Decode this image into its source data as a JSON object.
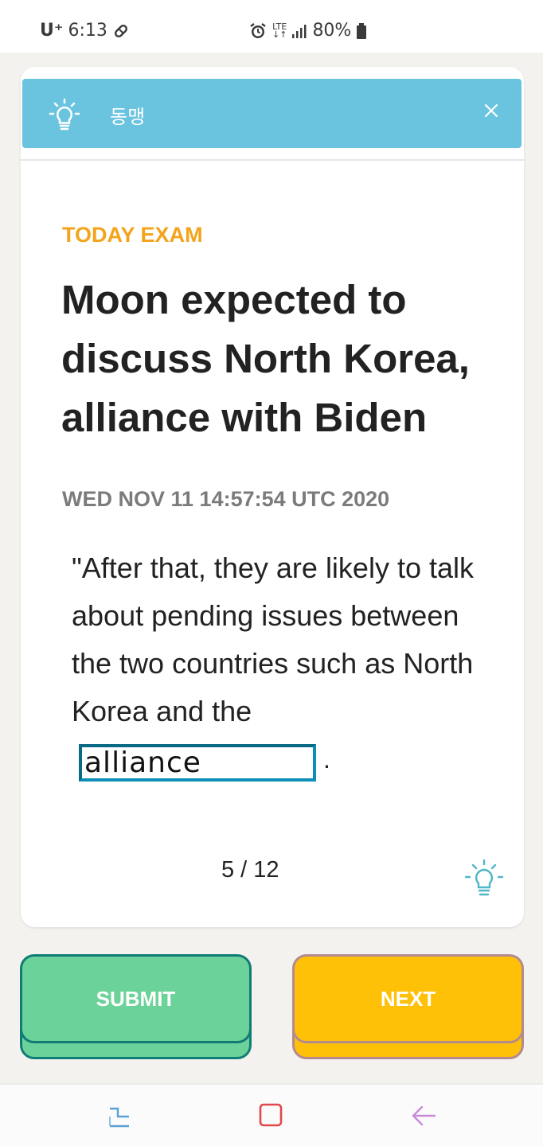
{
  "status_bar": {
    "carrier": "U⁺",
    "time": "6:13",
    "network": "LTE",
    "battery": "80%",
    "icons": [
      "pill-icon",
      "alarm-icon",
      "lte-icon",
      "signal-icon",
      "battery-icon"
    ]
  },
  "banner": {
    "label": "동맹",
    "icon": "lightbulb-icon",
    "close_icon": "close-icon",
    "color": "#6ac4df"
  },
  "exam": {
    "section_label": "TODAY EXAM",
    "headline": "Moon expected to discuss North Korea, alliance with Biden",
    "date": "WED NOV 11 14:57:54 UTC 2020",
    "quote": "\"After that, they are likely to talk about pending issues between the two countries such as North Korea and the",
    "answer_value": "alliance",
    "period": ".",
    "pager": "5 / 12",
    "hint_icon": "lightbulb-icon"
  },
  "buttons": {
    "submit_label": "SUBMIT",
    "next_label": "NEXT",
    "submit_color": "#6bd299",
    "next_color": "#fec107"
  },
  "nav": {
    "icons": [
      "recent-apps-icon",
      "home-icon",
      "back-icon"
    ]
  },
  "colors": {
    "accent_orange": "#f4a41c",
    "banner_blue": "#6ac4df",
    "answer_border": "#0b8fb8"
  }
}
